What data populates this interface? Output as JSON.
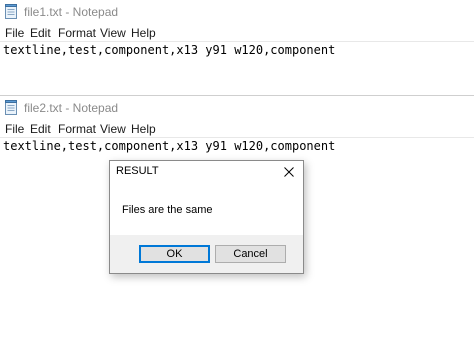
{
  "windows": [
    {
      "title": "file1.txt - Notepad",
      "menu": [
        "File",
        "Edit",
        "Format",
        "View",
        "Help"
      ],
      "content": "textline,test,component,x13 y91 w120,component"
    },
    {
      "title": "file2.txt - Notepad",
      "menu": [
        "File",
        "Edit",
        "Format",
        "View",
        "Help"
      ],
      "content": "textline,test,component,x13 y91 w120,component"
    }
  ],
  "dialog": {
    "title": "RESULT",
    "message": "Files are the same",
    "ok_label": "OK",
    "cancel_label": "Cancel"
  },
  "icons": {
    "notepad": "notepad-icon",
    "close": "close-icon"
  },
  "colors": {
    "accent": "#0078d7",
    "title_inactive": "#8a8a8a",
    "dialog_footer": "#f0f0f0"
  }
}
